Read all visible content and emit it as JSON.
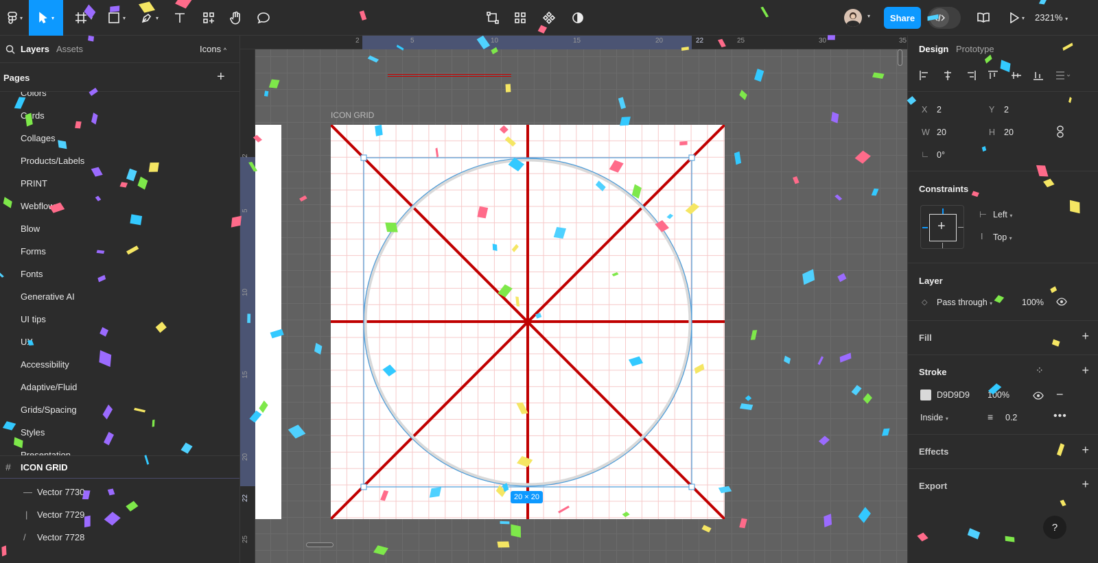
{
  "toolbar": {
    "share_label": "Share",
    "zoom": "2321%"
  },
  "left_panel": {
    "tabs": [
      "Layers",
      "Assets"
    ],
    "page_selector": "Icons",
    "pages_title": "Pages",
    "pages": [
      "Colors",
      "Cards",
      "Collages",
      "Products/Labels",
      "PRINT",
      "Webflow",
      "Blow",
      "Forms",
      "Fonts",
      "Generative AI",
      "UI tips",
      "UX",
      "Accessibility",
      "Adaptive/Fluid",
      "Grids/Spacing",
      "Styles",
      "Presentation"
    ],
    "frame_name": "ICON GRID",
    "layers": [
      "Vector 7730",
      "Vector 7729",
      "Vector 7728"
    ]
  },
  "rulers": {
    "top": [
      "2",
      "5",
      "10",
      "15",
      "20",
      "22",
      "25",
      "30",
      "35"
    ],
    "left": [
      "2",
      "5",
      "10",
      "15",
      "20",
      "22",
      "25"
    ]
  },
  "canvas": {
    "frame_label": "ICON GRID",
    "size_badge": "20 × 20"
  },
  "right_panel": {
    "tabs": [
      "Design",
      "Prototype"
    ],
    "position": {
      "x_label": "X",
      "x": "2",
      "y_label": "Y",
      "y": "2"
    },
    "size": {
      "w_label": "W",
      "w": "20",
      "h_label": "H",
      "h": "20"
    },
    "rotation": "0°",
    "constraints_title": "Constraints",
    "constraint_h": "Left",
    "constraint_v": "Top",
    "layer_title": "Layer",
    "blend_mode": "Pass through",
    "layer_opacity": "100%",
    "fill_title": "Fill",
    "stroke_title": "Stroke",
    "stroke_color": "D9D9D9",
    "stroke_opacity": "100%",
    "stroke_position": "Inside",
    "stroke_weight": "0.2",
    "effects_title": "Effects",
    "export_title": "Export",
    "help": "?"
  },
  "colors": {
    "accent": "#0d99ff",
    "panel": "#2c2c2c",
    "canvas": "#616161",
    "guide_red": "#c00000",
    "selection": "#4a9bd9"
  }
}
